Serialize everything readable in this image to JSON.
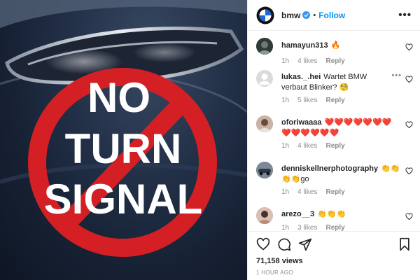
{
  "media": {
    "sign_line1": "NO",
    "sign_line2": "TURN",
    "sign_line3": "SIGNAL",
    "sign_color": "#d42024"
  },
  "header": {
    "username": "bmw",
    "separator": "•",
    "follow_label": "Follow",
    "more_label": "•••",
    "accent": "#0095f6"
  },
  "comments": [
    {
      "user": "hamayun313",
      "text": "🔥",
      "time": "1h",
      "likes": "4 likes",
      "reply": "Reply"
    },
    {
      "user": "lukas._.hei",
      "text": "Wartet BMW verbaut Blinker? 🧐",
      "time": "1h",
      "likes": "5 likes",
      "reply": "Reply",
      "more_label": "•••"
    },
    {
      "user": "oforiwaaaa",
      "text": "❤️❤️❤️❤️❤️❤️❤️❤️❤️❤️❤️❤️❤️",
      "time": "1h",
      "likes": "4 likes",
      "reply": "Reply"
    },
    {
      "user": "denniskellnerphotography",
      "text": "👏👏👏👏go",
      "time": "1h",
      "likes": "4 likes",
      "reply": "Reply"
    },
    {
      "user": "arezo__3",
      "text": "👏👏👏",
      "time": "1h",
      "likes": "3 likes",
      "reply": "Reply"
    }
  ],
  "footer": {
    "views": "71,158 views",
    "posted": "1 HOUR AGO"
  }
}
